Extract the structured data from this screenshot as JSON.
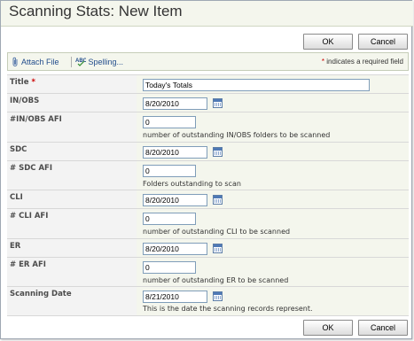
{
  "page": {
    "title": "Scanning Stats: New Item"
  },
  "buttons": {
    "ok_label": "OK",
    "cancel_label": "Cancel"
  },
  "toolbar": {
    "attach_file": "Attach File",
    "spelling": "Spelling...",
    "required_star": "*",
    "required_note": " indicates a required field"
  },
  "fields": {
    "title": {
      "label": "Title",
      "required_star": "*",
      "value": "Today's Totals"
    },
    "in_obs": {
      "label": "IN/OBS",
      "value": "8/20/2010"
    },
    "in_obs_afi": {
      "label": "#IN/OBS AFI",
      "value": "0",
      "description": "number of outstanding IN/OBS folders to be scanned"
    },
    "sdc": {
      "label": "SDC",
      "value": "8/20/2010"
    },
    "sdc_afi": {
      "label": "# SDC AFI",
      "value": "0",
      "description": "Folders outstanding to scan"
    },
    "cli": {
      "label": "CLI",
      "value": "8/20/2010"
    },
    "cli_afi": {
      "label": "# CLI AFI",
      "value": "0",
      "description": "number of outstanding CLI  to be scanned"
    },
    "er": {
      "label": "ER",
      "value": "8/20/2010"
    },
    "er_afi": {
      "label": "# ER AFI",
      "value": "0",
      "description": "number of outstanding ER to be scanned"
    },
    "scanning_date": {
      "label": "Scanning Date",
      "value": "8/21/2010",
      "description": "This is the date the scanning records represent."
    }
  },
  "icons": {
    "attach": "paperclip-icon",
    "spelling": "spellcheck-icon",
    "calendar": "calendar-icon"
  },
  "colors": {
    "title_bar": "#f4f6ed",
    "label_cell": "#f3f3f3",
    "value_cell": "#f4f6ed",
    "link": "#224d8c",
    "required": "#cc0000"
  }
}
